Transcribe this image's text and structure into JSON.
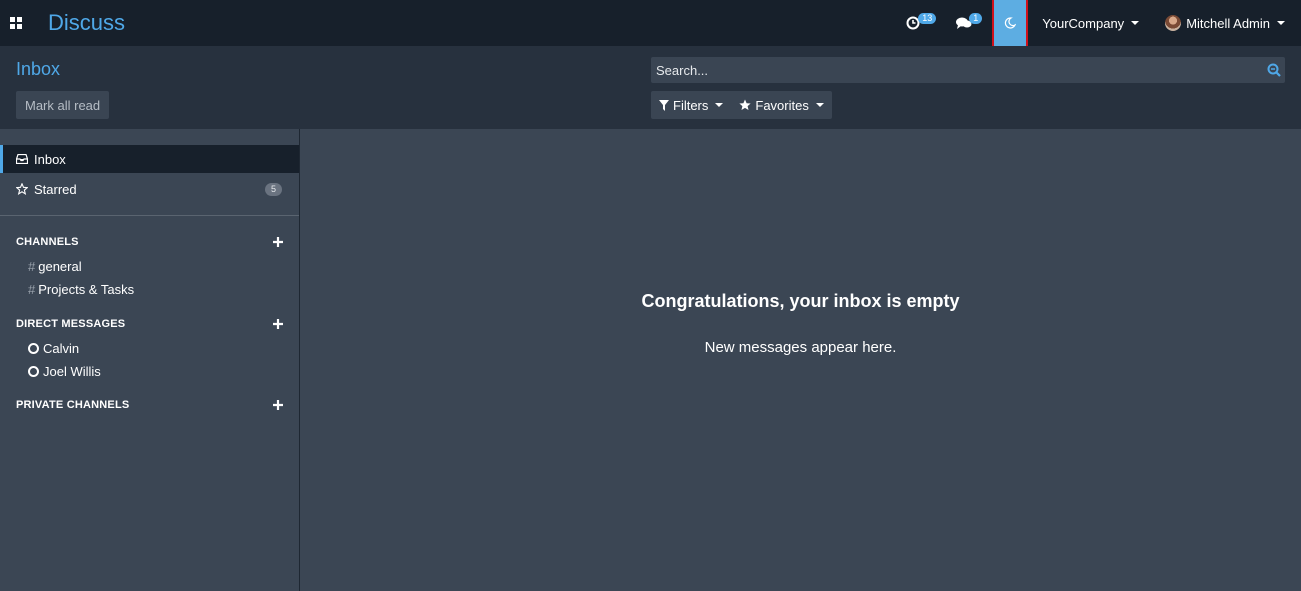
{
  "navbar": {
    "app_title": "Discuss",
    "activity_count": "13",
    "messages_count": "1",
    "company": "YourCompany",
    "user": "Mitchell Admin"
  },
  "control_panel": {
    "title": "Inbox",
    "mark_all_read": "Mark all read",
    "search_placeholder": "Search...",
    "filters_label": "Filters",
    "favorites_label": "Favorites"
  },
  "sidebar": {
    "mailboxes": [
      {
        "label": "Inbox",
        "icon": "inbox-icon"
      },
      {
        "label": "Starred",
        "icon": "star-icon",
        "count": "5"
      }
    ],
    "channels_header": "CHANNELS",
    "channels": [
      "general",
      "Projects & Tasks"
    ],
    "dm_header": "DIRECT MESSAGES",
    "direct_messages": [
      "Calvin",
      "Joel Willis"
    ],
    "private_header": "PRIVATE CHANNELS"
  },
  "main": {
    "empty_title": "Congratulations, your inbox is empty",
    "empty_subtitle": "New messages appear here."
  },
  "colors": {
    "accent": "#4fa8e8",
    "navbar_bg": "#17202b",
    "panel_bg": "#27313e",
    "content_bg": "#3b4654",
    "highlight_outline": "#d0111b"
  }
}
